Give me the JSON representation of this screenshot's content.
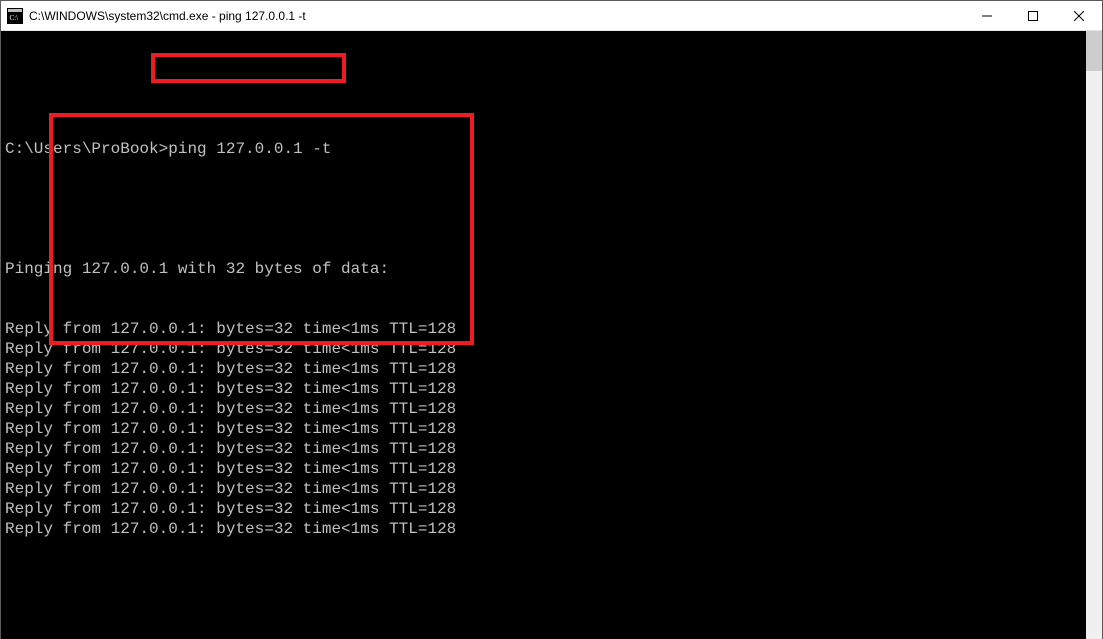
{
  "window": {
    "title": "C:\\WINDOWS\\system32\\cmd.exe - ping  127.0.0.1 -t"
  },
  "terminal": {
    "prompt": "C:\\Users\\ProBook>",
    "command": "ping 127.0.0.1 -t",
    "header": "Pinging 127.0.0.1 with 32 bytes of data:",
    "replies": [
      "Reply from 127.0.0.1: bytes=32 time<1ms TTL=128",
      "Reply from 127.0.0.1: bytes=32 time<1ms TTL=128",
      "Reply from 127.0.0.1: bytes=32 time<1ms TTL=128",
      "Reply from 127.0.0.1: bytes=32 time<1ms TTL=128",
      "Reply from 127.0.0.1: bytes=32 time<1ms TTL=128",
      "Reply from 127.0.0.1: bytes=32 time<1ms TTL=128",
      "Reply from 127.0.0.1: bytes=32 time<1ms TTL=128",
      "Reply from 127.0.0.1: bytes=32 time<1ms TTL=128",
      "Reply from 127.0.0.1: bytes=32 time<1ms TTL=128",
      "Reply from 127.0.0.1: bytes=32 time<1ms TTL=128",
      "Reply from 127.0.0.1: bytes=32 time<1ms TTL=128"
    ]
  }
}
